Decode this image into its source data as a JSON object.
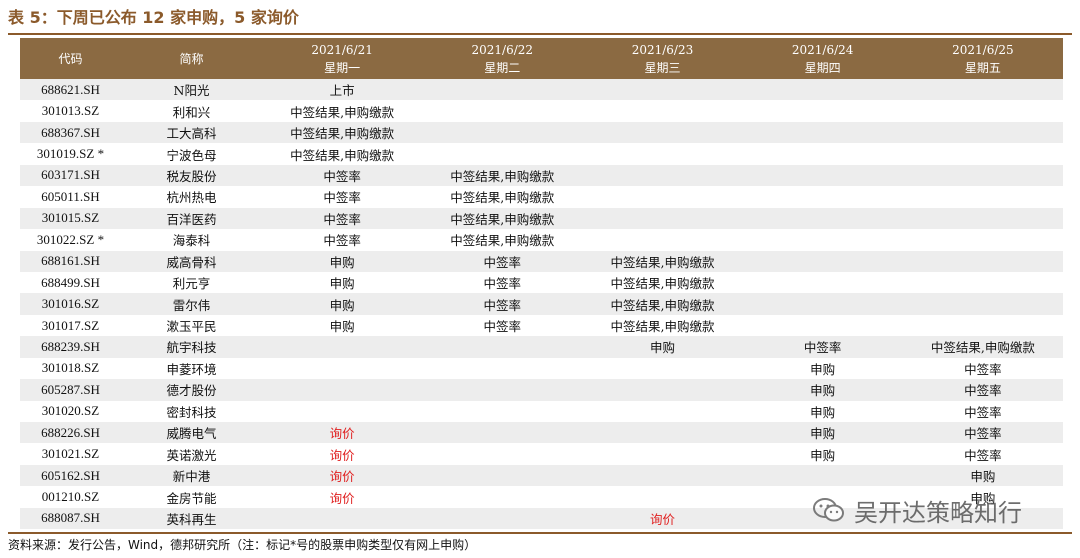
{
  "title": "表 5：下周已公布 12 家申购，5 家询价",
  "colors": {
    "accent": "#8B5A2B",
    "header_bg": "#8B6A42",
    "red_text": "#E02020",
    "stripe": "#EDEDED"
  },
  "table": {
    "headers": {
      "code": "代码",
      "name": "简称",
      "days": [
        {
          "date": "2021/6/21",
          "weekday": "星期一"
        },
        {
          "date": "2021/6/22",
          "weekday": "星期二"
        },
        {
          "date": "2021/6/23",
          "weekday": "星期三"
        },
        {
          "date": "2021/6/24",
          "weekday": "星期四"
        },
        {
          "date": "2021/6/25",
          "weekday": "星期五"
        }
      ]
    },
    "rows": [
      {
        "code": "688621.SH",
        "name": "N阳光",
        "days": [
          "上市",
          "",
          "",
          "",
          ""
        ]
      },
      {
        "code": "301013.SZ",
        "name": "利和兴",
        "days": [
          "中签结果,申购缴款",
          "",
          "",
          "",
          ""
        ]
      },
      {
        "code": "688367.SH",
        "name": "工大高科",
        "days": [
          "中签结果,申购缴款",
          "",
          "",
          "",
          ""
        ]
      },
      {
        "code": "301019.SZ *",
        "name": "宁波色母",
        "days": [
          "中签结果,申购缴款",
          "",
          "",
          "",
          ""
        ]
      },
      {
        "code": "603171.SH",
        "name": "税友股份",
        "days": [
          "中签率",
          "中签结果,申购缴款",
          "",
          "",
          ""
        ]
      },
      {
        "code": "605011.SH",
        "name": "杭州热电",
        "days": [
          "中签率",
          "中签结果,申购缴款",
          "",
          "",
          ""
        ]
      },
      {
        "code": "301015.SZ",
        "name": "百洋医药",
        "days": [
          "中签率",
          "中签结果,申购缴款",
          "",
          "",
          ""
        ]
      },
      {
        "code": "301022.SZ *",
        "name": "海泰科",
        "days": [
          "中签率",
          "中签结果,申购缴款",
          "",
          "",
          ""
        ]
      },
      {
        "code": "688161.SH",
        "name": "威高骨科",
        "days": [
          "申购",
          "中签率",
          "中签结果,申购缴款",
          "",
          ""
        ]
      },
      {
        "code": "688499.SH",
        "name": "利元亨",
        "days": [
          "申购",
          "中签率",
          "中签结果,申购缴款",
          "",
          ""
        ]
      },
      {
        "code": "301016.SZ",
        "name": "雷尔伟",
        "days": [
          "申购",
          "中签率",
          "中签结果,申购缴款",
          "",
          ""
        ]
      },
      {
        "code": "301017.SZ",
        "name": "漱玉平民",
        "days": [
          "申购",
          "中签率",
          "中签结果,申购缴款",
          "",
          ""
        ]
      },
      {
        "code": "688239.SH",
        "name": "航宇科技",
        "days": [
          "",
          "",
          "申购",
          "中签率",
          "中签结果,申购缴款"
        ]
      },
      {
        "code": "301018.SZ",
        "name": "申菱环境",
        "days": [
          "",
          "",
          "",
          "申购",
          "中签率"
        ]
      },
      {
        "code": "605287.SH",
        "name": "德才股份",
        "days": [
          "",
          "",
          "",
          "申购",
          "中签率"
        ]
      },
      {
        "code": "301020.SZ",
        "name": "密封科技",
        "days": [
          "",
          "",
          "",
          "申购",
          "中签率"
        ]
      },
      {
        "code": "688226.SH",
        "name": "威腾电气",
        "days": [
          "询价",
          "",
          "",
          "申购",
          "中签率"
        ]
      },
      {
        "code": "301021.SZ",
        "name": "英诺激光",
        "days": [
          "询价",
          "",
          "",
          "申购",
          "中签率"
        ]
      },
      {
        "code": "605162.SH",
        "name": "新中港",
        "days": [
          "询价",
          "",
          "",
          "",
          "申购"
        ]
      },
      {
        "code": "001210.SZ",
        "name": "金房节能",
        "days": [
          "询价",
          "",
          "",
          "",
          "申购"
        ]
      },
      {
        "code": "688087.SH",
        "name": "英科再生",
        "days": [
          "",
          "",
          "询价",
          "",
          ""
        ]
      }
    ]
  },
  "source": "资料来源：发行公告，Wind，德邦研究所（注：标记*号的股票申购类型仅有网上申购）",
  "watermark": {
    "text": "吴开达策略知行",
    "icon": "wechat-icon"
  }
}
